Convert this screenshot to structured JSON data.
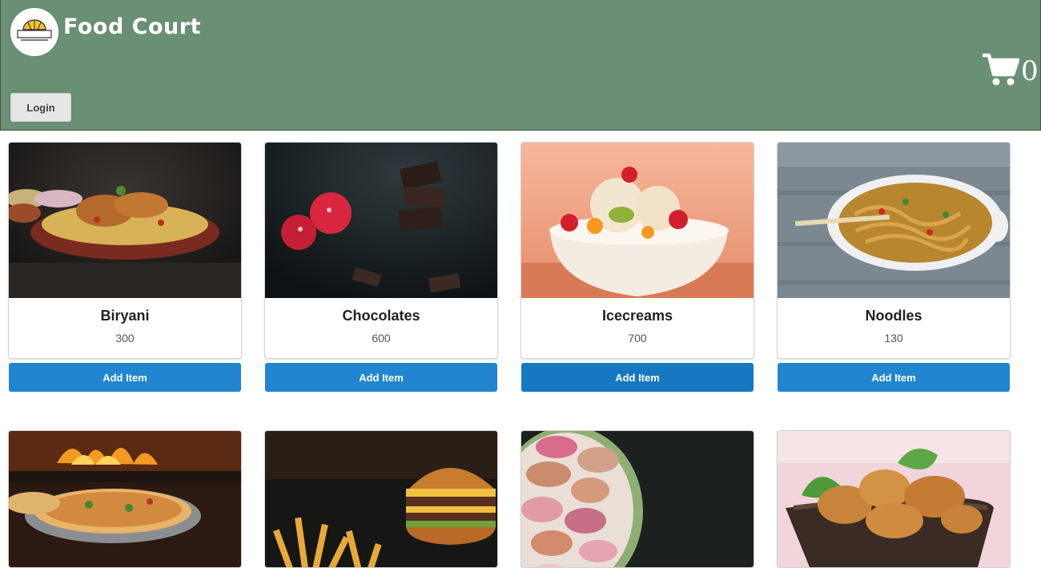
{
  "header": {
    "brand": "Food Court",
    "logo_text": "FOOD COURT",
    "login_label": "Login",
    "cart_count": "0",
    "background_color": "#6a8f74"
  },
  "products": [
    {
      "name": "Biryani",
      "price": "300",
      "button": "Add Item"
    },
    {
      "name": "Chocolates",
      "price": "600",
      "button": "Add Item"
    },
    {
      "name": "Icecreams",
      "price": "700",
      "button": "Add Item"
    },
    {
      "name": "Noodles",
      "price": "130",
      "button": "Add Item"
    }
  ],
  "colors": {
    "button_blue": "#2185d0",
    "button_blue_hover": "#1678c2"
  },
  "icons": [
    "logo-icon",
    "cart-icon"
  ]
}
